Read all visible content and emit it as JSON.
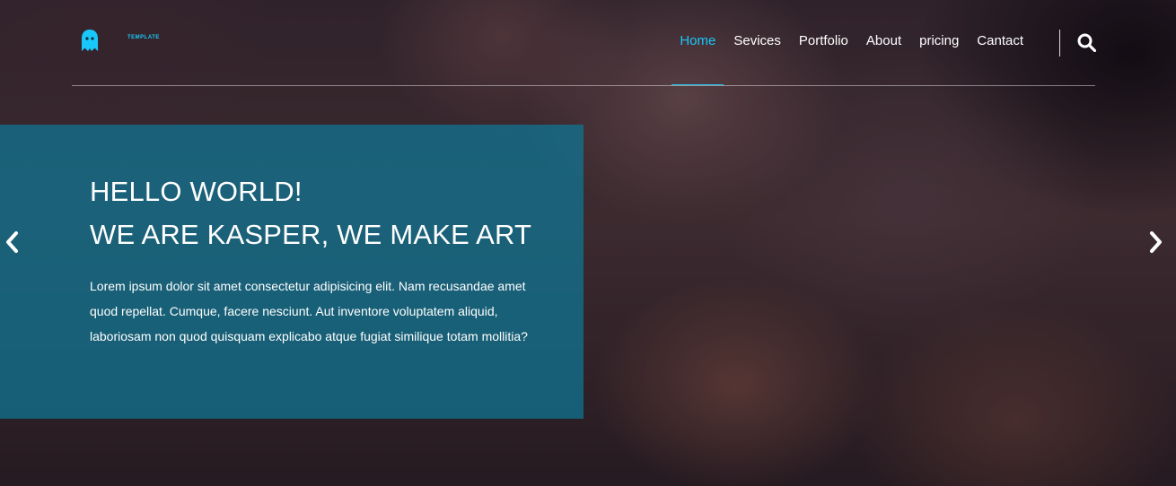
{
  "brand": {
    "logo_text": "TEMPLATE",
    "accent_color": "#19c8fa",
    "logo_icon": "ghost-icon"
  },
  "nav": {
    "items": [
      {
        "label": "Home",
        "active": true
      },
      {
        "label": "Sevices",
        "active": false
      },
      {
        "label": "Portfolio",
        "active": false
      },
      {
        "label": "About",
        "active": false
      },
      {
        "label": "pricing",
        "active": false
      },
      {
        "label": "Cantact",
        "active": false
      }
    ],
    "search_icon": "search-icon"
  },
  "hero": {
    "title_line_1": "HELLO WORLD!",
    "title_line_2": "WE ARE KASPER, WE MAKE ART",
    "description": "Lorem ipsum dolor sit amet consectetur adipisicing elit. Nam recusandae amet quod repellat. Cumque, facere nesciunt. Aut inventore voluptatem aliquid, laboriosam non quod quisquam explicabo atque fugiat similique totam mollitia?",
    "panel_color": "#0e7796",
    "prev_icon": "chevron-left-icon",
    "next_icon": "chevron-right-icon"
  }
}
